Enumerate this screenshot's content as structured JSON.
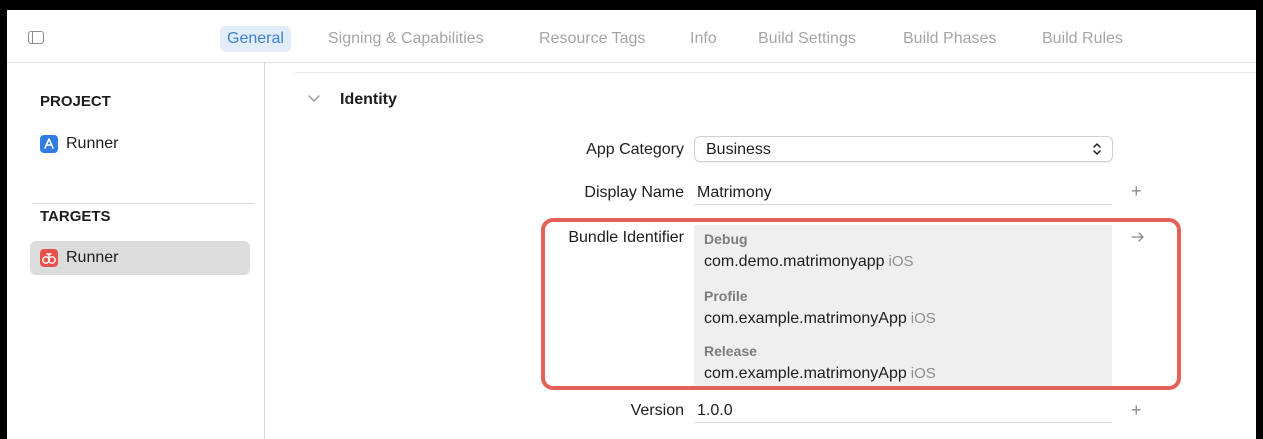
{
  "tabs": [
    {
      "label": "General",
      "active": true
    },
    {
      "label": "Signing & Capabilities",
      "active": false
    },
    {
      "label": "Resource Tags",
      "active": false
    },
    {
      "label": "Info",
      "active": false
    },
    {
      "label": "Build Settings",
      "active": false
    },
    {
      "label": "Build Phases",
      "active": false
    },
    {
      "label": "Build Rules",
      "active": false
    }
  ],
  "sidebar": {
    "project_header": "PROJECT",
    "project_item": "Runner",
    "targets_header": "TARGETS",
    "target_item": "Runner"
  },
  "identity": {
    "section_title": "Identity",
    "app_category": {
      "label": "App Category",
      "value": "Business"
    },
    "display_name": {
      "label": "Display Name",
      "value": "Matrimony"
    },
    "bundle_identifier": {
      "label": "Bundle Identifier",
      "configs": [
        {
          "name": "Debug",
          "id": "com.demo.matrimonyapp",
          "platform": "iOS"
        },
        {
          "name": "Profile",
          "id": "com.example.matrimonyApp",
          "platform": "iOS"
        },
        {
          "name": "Release",
          "id": "com.example.matrimonyApp",
          "platform": "iOS"
        }
      ]
    },
    "version": {
      "label": "Version",
      "value": "1.0.0"
    }
  },
  "colors": {
    "accent": "#3b82d6",
    "tab_active_bg": "#e3edf9",
    "highlight_border": "#e4605a",
    "selected_row": "#dcdcdc"
  },
  "icons": {
    "sidebar_toggle": "sidebar-toggle-icon",
    "project": "app-store-icon",
    "target": "flutter-runner-icon",
    "disclosure": "chevron-down-icon",
    "stepper": "up-down-chevron-icon",
    "add": "plus-icon",
    "go": "arrow-right-icon"
  }
}
